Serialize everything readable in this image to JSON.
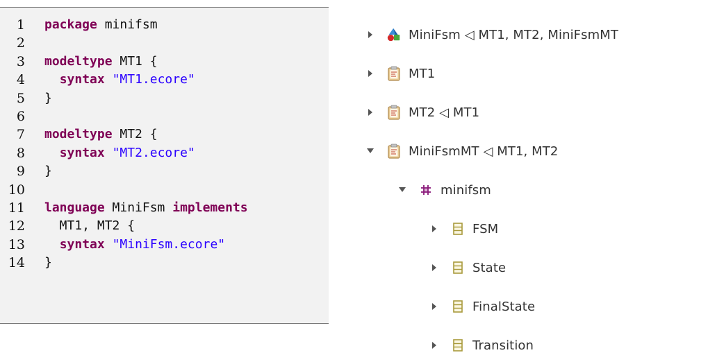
{
  "code": {
    "lines": [
      {
        "n": "1",
        "tokens": [
          {
            "t": "package",
            "k": "kw"
          },
          {
            "t": " minifsm",
            "k": ""
          }
        ]
      },
      {
        "n": "2",
        "tokens": []
      },
      {
        "n": "3",
        "tokens": [
          {
            "t": "modeltype",
            "k": "kw"
          },
          {
            "t": " MT1 {",
            "k": ""
          }
        ]
      },
      {
        "n": "4",
        "tokens": [
          {
            "t": "  ",
            "k": ""
          },
          {
            "t": "syntax",
            "k": "kw"
          },
          {
            "t": " ",
            "k": ""
          },
          {
            "t": "\"MT1.ecore\"",
            "k": "str"
          }
        ]
      },
      {
        "n": "5",
        "tokens": [
          {
            "t": "}",
            "k": ""
          }
        ]
      },
      {
        "n": "6",
        "tokens": []
      },
      {
        "n": "7",
        "tokens": [
          {
            "t": "modeltype",
            "k": "kw"
          },
          {
            "t": " MT2 {",
            "k": ""
          }
        ]
      },
      {
        "n": "8",
        "tokens": [
          {
            "t": "  ",
            "k": ""
          },
          {
            "t": "syntax",
            "k": "kw"
          },
          {
            "t": " ",
            "k": ""
          },
          {
            "t": "\"MT2.ecore\"",
            "k": "str"
          }
        ]
      },
      {
        "n": "9",
        "tokens": [
          {
            "t": "}",
            "k": ""
          }
        ]
      },
      {
        "n": "10",
        "tokens": []
      },
      {
        "n": "11",
        "tokens": [
          {
            "t": "language",
            "k": "kw"
          },
          {
            "t": " MiniFsm ",
            "k": ""
          },
          {
            "t": "implements",
            "k": "kw"
          }
        ]
      },
      {
        "n": "12",
        "tokens": [
          {
            "t": "  MT1, MT2 {",
            "k": ""
          }
        ]
      },
      {
        "n": "13",
        "tokens": [
          {
            "t": "  ",
            "k": ""
          },
          {
            "t": "syntax",
            "k": "kw"
          },
          {
            "t": " ",
            "k": ""
          },
          {
            "t": "\"MiniFsm.ecore\"",
            "k": "str"
          }
        ]
      },
      {
        "n": "14",
        "tokens": [
          {
            "t": "}",
            "k": ""
          }
        ]
      }
    ]
  },
  "tree": {
    "items": [
      {
        "label": "MiniFsm ◁ MT1, MT2, MiniFsmMT",
        "icon": "language-icon",
        "expanded": false,
        "depth": 0
      },
      {
        "label": "MT1",
        "icon": "modeltype-icon",
        "expanded": false,
        "depth": 0
      },
      {
        "label": "MT2 ◁ MT1",
        "icon": "modeltype-icon",
        "expanded": false,
        "depth": 0
      },
      {
        "label": "MiniFsmMT ◁ MT1, MT2",
        "icon": "modeltype-icon",
        "expanded": true,
        "depth": 0
      },
      {
        "label": "minifsm",
        "icon": "package-icon",
        "expanded": true,
        "depth": 1
      },
      {
        "label": "FSM",
        "icon": "class-icon",
        "expanded": false,
        "depth": 2
      },
      {
        "label": "State",
        "icon": "class-icon",
        "expanded": false,
        "depth": 2
      },
      {
        "label": "FinalState",
        "icon": "class-icon",
        "expanded": false,
        "depth": 2
      },
      {
        "label": "Transition",
        "icon": "class-icon",
        "expanded": false,
        "depth": 2
      }
    ]
  },
  "colors": {
    "keyword": "#7f0055",
    "string": "#2a00ff",
    "code_background": "#f2f2f2",
    "package_icon": "#8a1a7a",
    "class_icon": "#a89a3c"
  }
}
